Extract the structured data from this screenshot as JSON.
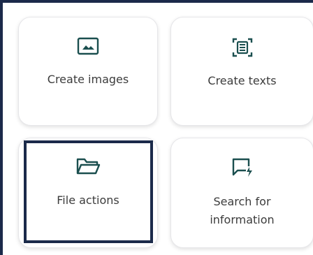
{
  "colors": {
    "icon": "#1b4f4f",
    "text": "#3c3c3c",
    "frame_border": "#1b2a4a",
    "selection_outline": "#1b2a4a",
    "card_background": "#ffffff"
  },
  "cards": [
    {
      "label": "Create images",
      "icon": "image-icon"
    },
    {
      "label": "Create texts",
      "icon": "document-scan-icon"
    },
    {
      "label": "File actions",
      "icon": "folder-icon",
      "selected": true
    },
    {
      "label": "Search for information",
      "icon": "chat-search-icon"
    }
  ]
}
